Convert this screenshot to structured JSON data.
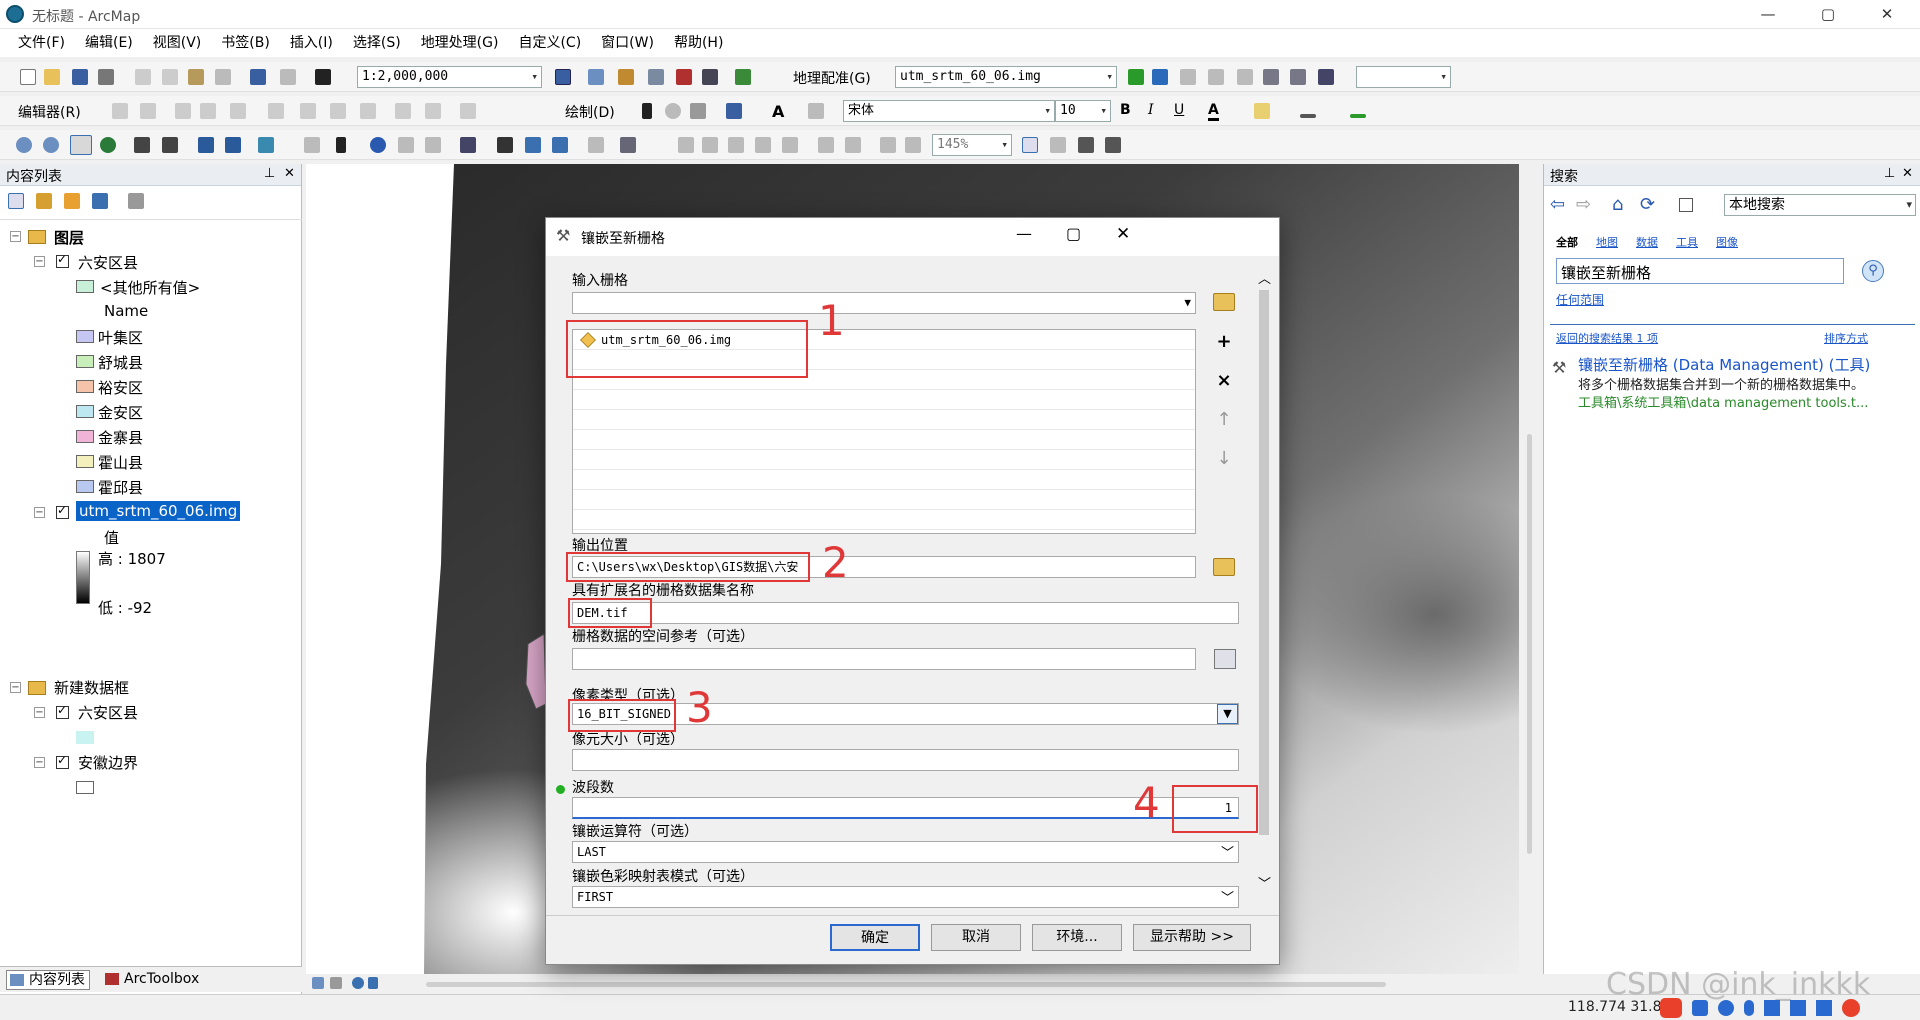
{
  "window": {
    "title": "无标题 - ArcMap",
    "controls": [
      "—",
      "▢",
      "✕"
    ]
  },
  "menu": [
    "文件(F)",
    "编辑(E)",
    "视图(V)",
    "书签(B)",
    "插入(I)",
    "选择(S)",
    "地理处理(G)",
    "自定义(C)",
    "窗口(W)",
    "帮助(H)"
  ],
  "toolbar1": {
    "scale": "1:2,000,000",
    "georef_label": "地理配准(G)",
    "georef_layer": "utm_srtm_60_06.img"
  },
  "toolbar2": {
    "editor_label": "编辑器(R)",
    "draw_label": "绘制(D)",
    "font": "宋体",
    "font_size": "10",
    "bold": "B",
    "italic": "I",
    "underline": "U",
    "text_a": "A"
  },
  "toolbar3": {
    "zoom": "145%"
  },
  "toc": {
    "title": "内容列表",
    "pin": "ᵖ",
    "close": "✕",
    "layers_label": "图层",
    "group1": "六安区县",
    "others": "<其他所有值>",
    "name_header": "Name",
    "classes": [
      {
        "label": "叶集区",
        "color": "#c6c6f3"
      },
      {
        "label": "舒城县",
        "color": "#c8efb9"
      },
      {
        "label": "裕安区",
        "color": "#f4c3aa"
      },
      {
        "label": "金安区",
        "color": "#bde8f1"
      },
      {
        "label": "金寨县",
        "color": "#f0b5d6"
      },
      {
        "label": "霍山县",
        "color": "#f3f0bd"
      },
      {
        "label": "霍邱县",
        "color": "#b9c8ee"
      }
    ],
    "raster_layer": "utm_srtm_60_06.img",
    "value_label": "值",
    "high_label": "高 : 1807",
    "low_label": "低 : -92",
    "frame2": "新建数据框",
    "frame2_layer1": "六安区县",
    "frame2_layer2": "安徽边界",
    "tabs": [
      "内容列表",
      "ArcToolbox"
    ]
  },
  "search": {
    "title": "搜索",
    "scope_select": "本地搜索",
    "filters": [
      "全部",
      "地图",
      "数据",
      "工具",
      "图像"
    ],
    "query": "镶嵌至新栅格",
    "any_extent": "任何范围",
    "results_count": "返回的搜索结果 1 项",
    "sort": "排序方式",
    "result_title": "镶嵌至新栅格 (Data Management) (工具)",
    "result_desc": "将多个栅格数据集合并到一个新的栅格数据集中。",
    "result_path": "工具箱\\系统工具箱\\data management tools.t..."
  },
  "status": {
    "coords": "118.774  31.80"
  },
  "watermark": "CSDN @ink_inkkk",
  "dialog": {
    "title": "镶嵌至新栅格",
    "input_label": "输入栅格",
    "input_items": [
      "utm_srtm_60_06.img"
    ],
    "output_loc_label": "输出位置",
    "output_loc": "C:\\Users\\wx\\Desktop\\GIS数据\\六安",
    "dataset_name_label": "具有扩展名的栅格数据集名称",
    "dataset_name": "DEM.tif",
    "spatial_ref_label": "栅格数据的空间参考（可选）",
    "pixel_type_label": "像素类型（可选）",
    "pixel_type": "16_BIT_SIGNED",
    "cell_size_label": "像元大小（可选）",
    "bands_label": "波段数",
    "bands_value": "1",
    "mosaic_op_label": "镶嵌运算符（可选）",
    "mosaic_op": "LAST",
    "colormap_label": "镶嵌色彩映射表模式（可选）",
    "colormap": "FIRST",
    "buttons": {
      "ok": "确定",
      "cancel": "取消",
      "env": "环境...",
      "help": "显示帮助 >>"
    },
    "annotations": [
      "1",
      "2",
      "3",
      "4"
    ]
  }
}
